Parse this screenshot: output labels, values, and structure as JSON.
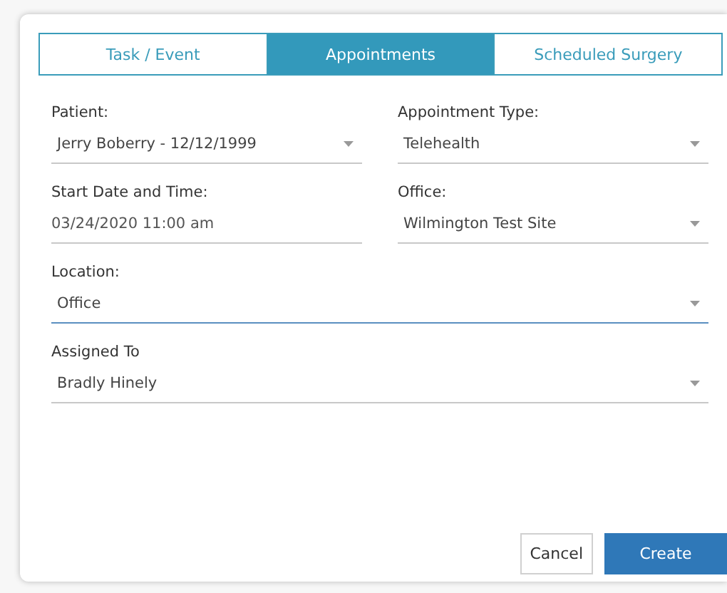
{
  "tabs": [
    {
      "label": "Task / Event",
      "selected": false
    },
    {
      "label": "Appointments",
      "selected": true
    },
    {
      "label": "Scheduled Surgery",
      "selected": false
    }
  ],
  "form_rows": [
    [
      {
        "label": "Patient:",
        "value": "Jerry Boberry - 12/12/1999",
        "kind": "dropdown",
        "focused": false
      },
      {
        "label": "Appointment Type:",
        "value": "Telehealth",
        "kind": "dropdown",
        "focused": false
      }
    ],
    [
      {
        "label": "Start Date and Time:",
        "value": "03/24/2020 11:00 am",
        "kind": "text",
        "focused": false
      },
      {
        "label": "Office:",
        "value": "Wilmington Test Site",
        "kind": "dropdown",
        "focused": false
      }
    ],
    [
      {
        "label": "Location:",
        "value": "Office",
        "kind": "dropdown",
        "focused": true
      }
    ],
    [
      {
        "label": "Assigned To",
        "value": "Bradly Hinely",
        "kind": "dropdown",
        "focused": false
      }
    ]
  ],
  "buttons": [
    {
      "label": "Cancel",
      "kind": "secondary"
    },
    {
      "label": "Create",
      "kind": "primary"
    }
  ]
}
